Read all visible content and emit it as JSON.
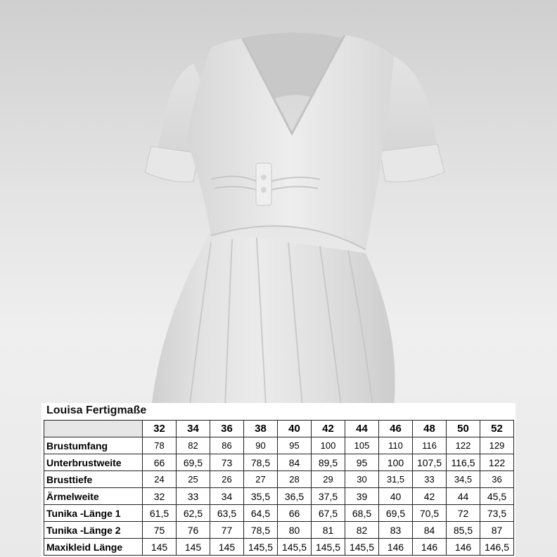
{
  "table": {
    "title": "Louisa Fertigmaße",
    "sizes": [
      "32",
      "34",
      "36",
      "38",
      "40",
      "42",
      "44",
      "46",
      "48",
      "50",
      "52"
    ],
    "rows": [
      {
        "label": "Brustumfang",
        "values": [
          "78",
          "82",
          "86",
          "90",
          "95",
          "100",
          "105",
          "110",
          "116",
          "122",
          "129"
        ]
      },
      {
        "label": "Unterbrustweite",
        "values": [
          "66",
          "69,5",
          "73",
          "78,5",
          "84",
          "89,5",
          "95",
          "100",
          "107,5",
          "116,5",
          "122"
        ]
      },
      {
        "label": "Brusttiefe",
        "values": [
          "24",
          "25",
          "26",
          "27",
          "28",
          "29",
          "30",
          "31,5",
          "33",
          "34,5",
          "36"
        ]
      },
      {
        "label": "Ärmelweite",
        "values": [
          "32",
          "33",
          "34",
          "35,5",
          "36,5",
          "37,5",
          "39",
          "40",
          "42",
          "44",
          "45,5"
        ]
      },
      {
        "label": "Tunika -Länge  1",
        "values": [
          "61,5",
          "62,5",
          "63,5",
          "64,5",
          "66",
          "67,5",
          "68,5",
          "69,5",
          "70,5",
          "72",
          "73,5"
        ]
      },
      {
        "label": "Tunika -Länge 2",
        "values": [
          "75",
          "76",
          "77",
          "78,5",
          "80",
          "81",
          "82",
          "83",
          "84",
          "85,5",
          "87"
        ]
      },
      {
        "label": "Maxikleid Länge",
        "values": [
          "145",
          "145",
          "145",
          "145,5",
          "145,5",
          "145,5",
          "145,5",
          "146",
          "146",
          "146",
          "146,5"
        ]
      }
    ]
  }
}
